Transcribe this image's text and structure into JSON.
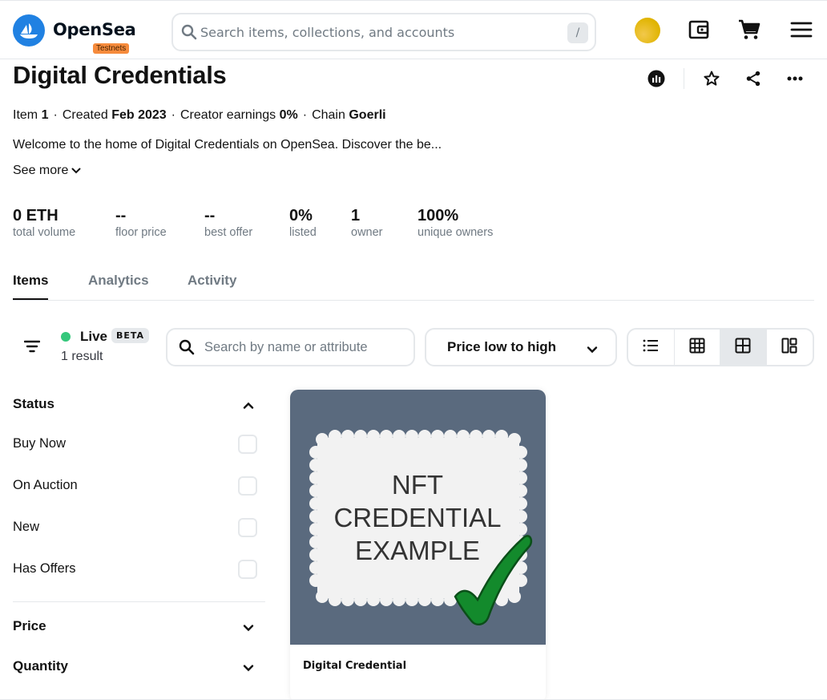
{
  "header": {
    "brand": "OpenSea",
    "badge": "Testnets",
    "search_placeholder": "Search items, collections, and accounts",
    "search_shortcut": "/"
  },
  "collection": {
    "title": "Digital Credentials",
    "meta": {
      "item_label": "Item",
      "item_value": "1",
      "created_label": "Created",
      "created_value": "Feb 2023",
      "earnings_label": "Creator earnings",
      "earnings_value": "0%",
      "chain_label": "Chain",
      "chain_value": "Goerli",
      "separator": "·"
    },
    "description": "Welcome to the home of Digital Credentials on OpenSea. Discover the be...",
    "see_more": "See more"
  },
  "stats": [
    {
      "value": "0 ETH",
      "label": "total volume"
    },
    {
      "value": "--",
      "label": "floor price"
    },
    {
      "value": "--",
      "label": "best offer"
    },
    {
      "value": "0%",
      "label": "listed"
    },
    {
      "value": "1",
      "label": "owner"
    },
    {
      "value": "100%",
      "label": "unique owners"
    }
  ],
  "tabs": [
    {
      "label": "Items",
      "active": true
    },
    {
      "label": "Analytics",
      "active": false
    },
    {
      "label": "Activity",
      "active": false
    }
  ],
  "toolbar": {
    "live_label": "Live",
    "beta_label": "BETA",
    "result_count": "1 result",
    "search_placeholder": "Search by name or attribute",
    "sort_label": "Price low to high"
  },
  "sidebar": {
    "status_title": "Status",
    "status_options": [
      {
        "label": "Buy Now",
        "checked": false
      },
      {
        "label": "On Auction",
        "checked": false
      },
      {
        "label": "New",
        "checked": false
      },
      {
        "label": "Has Offers",
        "checked": false
      }
    ],
    "price_title": "Price",
    "quantity_title": "Quantity"
  },
  "items": [
    {
      "name": "Digital Credential",
      "image_text": [
        "NFT",
        "CREDENTIAL",
        "EXAMPLE"
      ]
    }
  ],
  "colors": {
    "brand_blue": "#2081e2",
    "live_green": "#34c77b",
    "card_bg": "#5a6a7e",
    "check_green": "#138a2c",
    "badge_orange": "#f68b3c"
  }
}
